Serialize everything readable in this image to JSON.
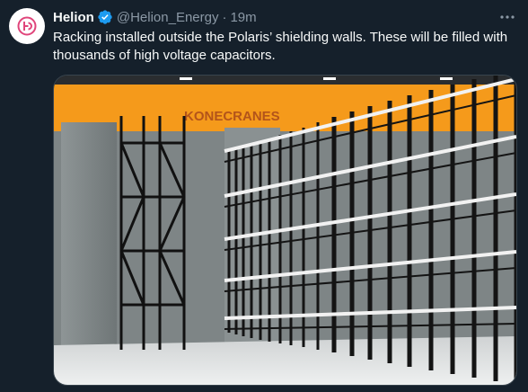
{
  "author": {
    "name": "Helion",
    "handle": "@Helion_Energy",
    "separator": "·",
    "time": "19m",
    "avatar_icon": "helion-logo-icon",
    "verified_icon": "verified-badge-icon"
  },
  "tweet": {
    "text": "Racking installed outside the Polaris’ shielding walls. These will be filled with thousands of high voltage capacitors."
  },
  "media": {
    "banner_text": "KONECRANES"
  },
  "more_icon": "more-options-icon",
  "colors": {
    "background": "#15202b",
    "text_primary": "#f7f9f9",
    "text_secondary": "#8b98a5",
    "verified_blue": "#1d9bf0",
    "brand_orange": "#f59a1b",
    "rack_black": "#1c1c1c"
  }
}
